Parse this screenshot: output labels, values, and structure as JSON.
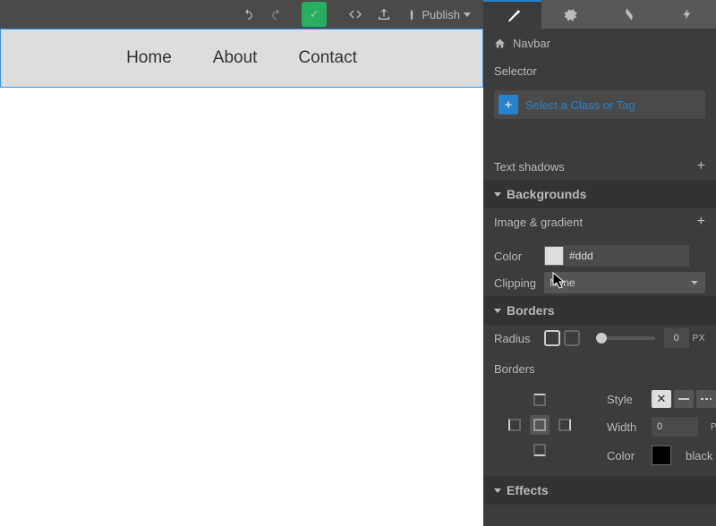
{
  "toolbar": {
    "publish_label": "Publish"
  },
  "navbar_preview": [
    "Home",
    "About",
    "Contact"
  ],
  "breadcrumb": {
    "label": "Navbar"
  },
  "selector": {
    "header": "Selector",
    "placeholder": "Select a Class or Tag"
  },
  "textShadows": {
    "label": "Text shadows"
  },
  "backgrounds": {
    "header": "Backgrounds",
    "imageGradient": "Image & gradient",
    "colorLabel": "Color",
    "colorValue": "#ddd",
    "clippingLabel": "Clipping",
    "clippingValue": "None"
  },
  "borders": {
    "header": "Borders",
    "radiusLabel": "Radius",
    "radiusValue": "0",
    "radiusUnit": "PX",
    "bordersLabel": "Borders",
    "styleLabel": "Style",
    "widthLabel": "Width",
    "widthValue": "0",
    "widthUnit": "PX",
    "colorLabel": "Color",
    "colorValue": "black"
  },
  "effects": {
    "header": "Effects"
  }
}
